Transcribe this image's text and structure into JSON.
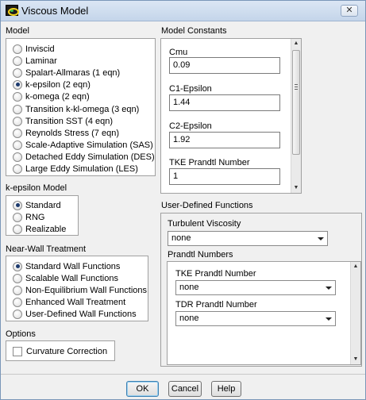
{
  "window": {
    "title": "Viscous Model",
    "close_label": "✕"
  },
  "model": {
    "label": "Model",
    "options": [
      "Inviscid",
      "Laminar",
      "Spalart-Allmaras (1 eqn)",
      "k-epsilon (2 eqn)",
      "k-omega (2 eqn)",
      "Transition k-kl-omega (3 eqn)",
      "Transition SST (4 eqn)",
      "Reynolds Stress (7 eqn)",
      "Scale-Adaptive Simulation (SAS)",
      "Detached Eddy Simulation (DES)",
      "Large Eddy Simulation (LES)"
    ],
    "selected": "k-epsilon (2 eqn)"
  },
  "k_epsilon": {
    "label": "k-epsilon Model",
    "options": [
      "Standard",
      "RNG",
      "Realizable"
    ],
    "selected": "Standard"
  },
  "near_wall": {
    "label": "Near-Wall Treatment",
    "options": [
      "Standard Wall Functions",
      "Scalable Wall Functions",
      "Non-Equilibrium Wall Functions",
      "Enhanced Wall Treatment",
      "User-Defined Wall Functions"
    ],
    "selected": "Standard Wall Functions"
  },
  "options": {
    "label": "Options",
    "curvature_correction": "Curvature Correction",
    "curvature_checked": false
  },
  "constants": {
    "label": "Model Constants",
    "fields": [
      {
        "label": "Cmu",
        "value": "0.09"
      },
      {
        "label": "C1-Epsilon",
        "value": "1.44"
      },
      {
        "label": "C2-Epsilon",
        "value": "1.92"
      },
      {
        "label": "TKE Prandtl Number",
        "value": "1"
      }
    ],
    "scroll_position": 0
  },
  "udf": {
    "label": "User-Defined Functions",
    "turbulent_viscosity_label": "Turbulent Viscosity",
    "turbulent_viscosity_value": "none",
    "prandtl_label": "Prandtl Numbers",
    "tke_label": "TKE Prandtl Number",
    "tke_value": "none",
    "tdr_label": "TDR Prandtl Number",
    "tdr_value": "none"
  },
  "buttons": {
    "ok": "OK",
    "cancel": "Cancel",
    "help": "Help"
  }
}
